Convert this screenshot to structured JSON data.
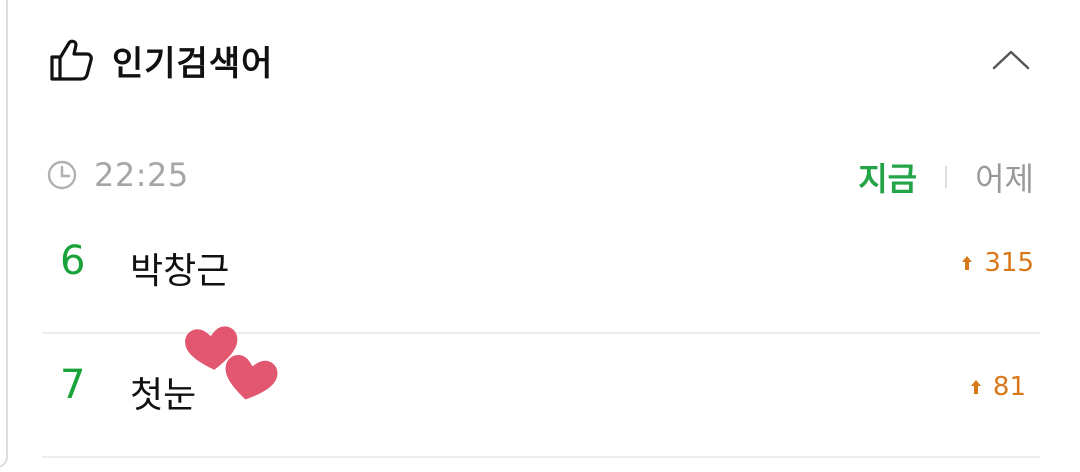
{
  "header": {
    "title": "인기검색어",
    "icon": "thumbs-up-icon",
    "collapse_icon": "chevron-up-icon"
  },
  "time": {
    "icon": "clock-icon",
    "value": "22:25"
  },
  "toggle": {
    "now_label": "지금",
    "yesterday_label": "어제",
    "active": "now"
  },
  "rankings": [
    {
      "rank": "6",
      "keyword": "박창근",
      "change_icon": "arrow-up-icon",
      "change": "315"
    },
    {
      "rank": "7",
      "keyword": "첫눈",
      "change_icon": "arrow-up-icon",
      "change": "81"
    }
  ],
  "decoration": {
    "sticker": "hearts-icon",
    "color": "#e25670"
  },
  "colors": {
    "rank_green": "#1aa33a",
    "now_green": "#22a447",
    "change_orange": "#d9781a",
    "muted_gray": "#a6a6a6"
  }
}
